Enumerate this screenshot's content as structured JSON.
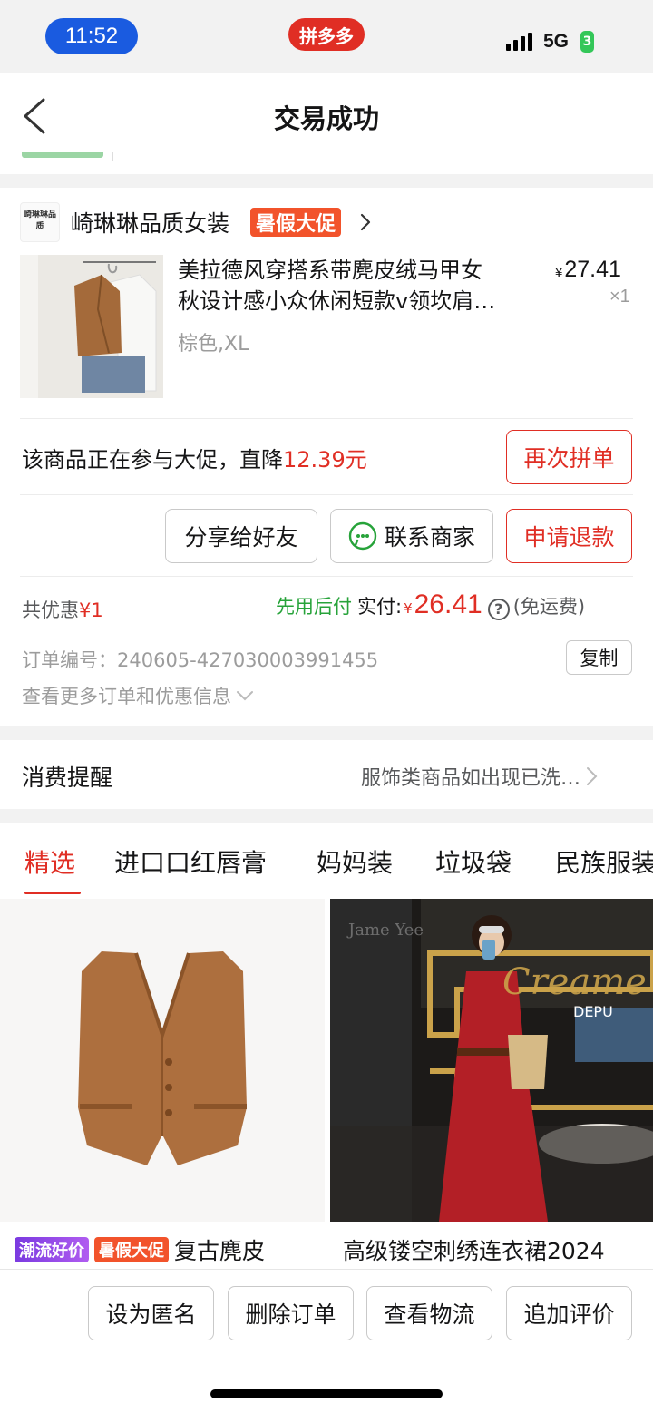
{
  "status_bar": {
    "time": "11:52",
    "app_badge": "拼多多",
    "network": "5G",
    "battery": "3"
  },
  "nav": {
    "title": "交易成功"
  },
  "shop": {
    "logo_text": "崎琳琳品质",
    "name": "崎琳琳品质女装",
    "promo_badge": "暑假大促"
  },
  "product": {
    "title_line1": "美拉德风穿搭系带麂皮绒马甲女",
    "title_line2": "秋设计感小众休闲短款v领坎肩…",
    "spec": "棕色,XL",
    "currency": "¥",
    "price": "27.41",
    "qty": "×1"
  },
  "promo": {
    "text": "该商品正在参与大促，直降",
    "amount": "12.39元",
    "button": "再次拼单"
  },
  "actions": {
    "share": "分享给好友",
    "contact": "联系商家",
    "refund": "申请退款"
  },
  "payment": {
    "discount_label": "共优惠",
    "discount_amount": "¥1",
    "pay_later": "先用后付",
    "paid_label": "实付:",
    "currency": "¥",
    "amount": "26.41",
    "help": "?",
    "shipping": "(免运费)"
  },
  "order": {
    "number": "订单编号：240605-427030003991455",
    "copy": "复制",
    "more_info": "查看更多订单和优惠信息"
  },
  "reminder": {
    "title": "消费提醒",
    "desc": "服饰类商品如出现已洗…"
  },
  "tabs": [
    "精选",
    "进口口红唇膏",
    "妈妈装",
    "垃圾袋",
    "民族服装"
  ],
  "feed": [
    {
      "tags": [
        "潮流好价",
        "暑假大促"
      ],
      "title": "复古麂皮"
    },
    {
      "title": "高级镂空刺绣连衣裙2024",
      "watermark": "Jame Yee",
      "sign": "Creame",
      "sign_sub": "DEPU"
    }
  ],
  "bottom": {
    "anon": "设为匿名",
    "delete": "删除订单",
    "logistics": "查看物流",
    "review": "追加评价"
  },
  "colors": {
    "accent_red": "#e02e24",
    "promo_orange": "#f2532b",
    "green": "#27a33a",
    "tag_purple": "#9a4de8",
    "status_blue": "#1a5be0"
  }
}
